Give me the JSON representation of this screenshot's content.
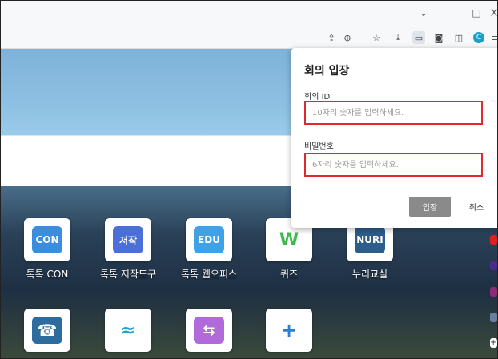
{
  "window": {
    "minimize_glyph": "_",
    "maximize_glyph": "□",
    "close_glyph": "X",
    "dropdown_glyph": "⌄"
  },
  "toolbar": {
    "icons": [
      "share-icon",
      "zoom-icon",
      "favorites-icon",
      "download-icon",
      "meet-icon",
      "screenshot-icon",
      "split-screen-icon",
      "profile-icon",
      "menu-icon"
    ],
    "profile_letter": "C",
    "menu_glyph": "≡"
  },
  "tiles": [
    {
      "name": "tok-con",
      "label": "톡톡 CON",
      "badge": "CON",
      "color": "#3c8dde"
    },
    {
      "name": "tok-creator",
      "label": "톡톡 저작도구",
      "badge": "저작",
      "color": "#4a6fd6"
    },
    {
      "name": "tok-weboffice",
      "label": "톡톡 웹오피스",
      "badge": "EDU",
      "color": "#3fa1e8"
    },
    {
      "name": "quiz",
      "label": "퀴즈",
      "badge": "W",
      "color": "#3dba4e"
    },
    {
      "name": "nuri",
      "label": "누리교실",
      "badge": "NURI",
      "color": "#2d5d8a"
    }
  ],
  "tiles_row2": [
    {
      "name": "phone",
      "glyph": "☎",
      "color": "#2e6c9e"
    },
    {
      "name": "app2",
      "glyph": "≈",
      "color": "#1fa3c8"
    },
    {
      "name": "app3",
      "glyph": "⇆",
      "color": "#b06ad9"
    },
    {
      "name": "add",
      "glyph": "+",
      "color": "#2a7fd4"
    }
  ],
  "popup": {
    "title": "회의 입장",
    "meeting_id_label": "회의 ID",
    "meeting_id_placeholder": "10자리 숫자를 입력하세요.",
    "password_label": "비밀번호",
    "password_placeholder": "6자리 숫자를 입력하세요.",
    "enter_label": "입장",
    "cancel_label": "취소"
  }
}
